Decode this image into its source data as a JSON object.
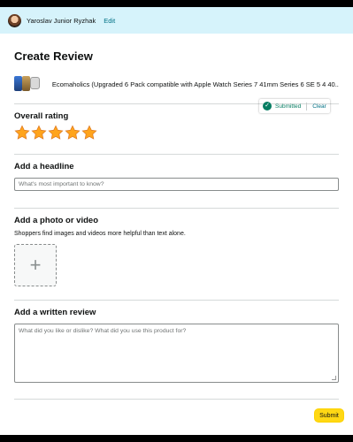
{
  "header": {
    "user_name": "Yaroslav Junior Ryzhak",
    "edit_label": "Edit"
  },
  "page_title": "Create Review",
  "product": {
    "name": "Ecomaholics (Upgraded 6 Pack compatible with Apple Watch Series 7 41mm Series 6 SE 5 4 40..."
  },
  "rating": {
    "title": "Overall rating",
    "value": 5,
    "max": 5,
    "status_text": "Submitted",
    "clear_label": "Clear",
    "star_color": "#ffa41c"
  },
  "headline": {
    "title": "Add a headline",
    "placeholder": "What's most important to know?"
  },
  "photo": {
    "title": "Add a photo or video",
    "subtitle": "Shoppers find images and videos more helpful than text alone."
  },
  "written": {
    "title": "Add a written review",
    "placeholder": "What did you like or dislike? What did you use this product for?"
  },
  "submit_label": "Submit",
  "colors": {
    "accent": "#007185",
    "success": "#067d62",
    "button": "#ffd814",
    "topbar": "#d6f3fb"
  }
}
